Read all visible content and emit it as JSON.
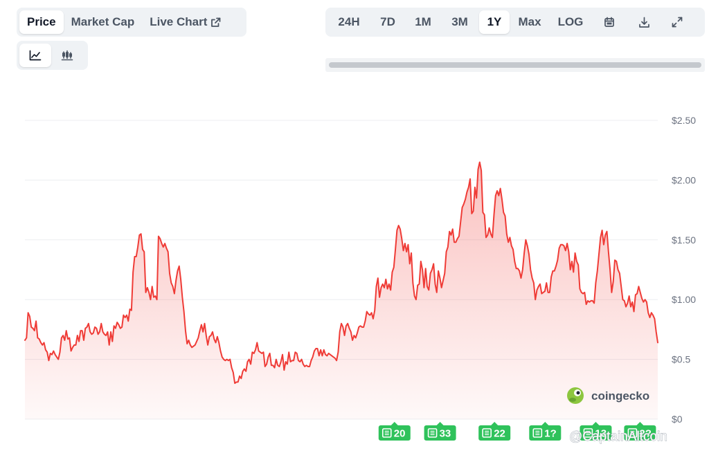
{
  "toolbar": {
    "type_tabs": [
      {
        "label": "Price",
        "active": true
      },
      {
        "label": "Market Cap",
        "active": false
      },
      {
        "label": "Live Chart",
        "active": false,
        "icon": "external-link-icon"
      }
    ],
    "view_toggle": [
      {
        "icon": "line-chart-icon",
        "active": true
      },
      {
        "icon": "candlestick-chart-icon",
        "active": false
      }
    ],
    "range_tabs": [
      {
        "label": "24H",
        "active": false
      },
      {
        "label": "7D",
        "active": false
      },
      {
        "label": "1M",
        "active": false
      },
      {
        "label": "3M",
        "active": false
      },
      {
        "label": "1Y",
        "active": true
      },
      {
        "label": "Max",
        "active": false
      },
      {
        "label": "LOG",
        "active": false
      }
    ],
    "icon_buttons": [
      "calendar-icon",
      "download-icon",
      "expand-icon"
    ]
  },
  "colors": {
    "line": "#ef3b36",
    "badge": "#2fc25b",
    "grid": "#eceef1",
    "axis_text": "#6b7280"
  },
  "watermark": {
    "brand": "coingecko",
    "handle": "@CaptainAltcoin"
  },
  "chart_data": {
    "type": "area",
    "title": "",
    "xlabel": "",
    "ylabel": "",
    "ylim": [
      0,
      2.5
    ],
    "ytick_labels": [
      "$0",
      "$0.5",
      "$1.00",
      "$1.50",
      "$2.00",
      "$2.50"
    ],
    "ytick_values": [
      0,
      0.5,
      1.0,
      1.5,
      2.0,
      2.5
    ],
    "x_range_label": "1Y",
    "grid": true,
    "series": [
      {
        "values": [
          0.66,
          0.68,
          0.89,
          0.86,
          0.77,
          0.76,
          0.74,
          0.82,
          0.68,
          0.67,
          0.64,
          0.62,
          0.64,
          0.58,
          0.56,
          0.49,
          0.55,
          0.54,
          0.57,
          0.54,
          0.52,
          0.5,
          0.56,
          0.68,
          0.7,
          0.66,
          0.74,
          0.67,
          0.68,
          0.57,
          0.6,
          0.62,
          0.62,
          0.7,
          0.65,
          0.74,
          0.74,
          0.66,
          0.76,
          0.77,
          0.8,
          0.73,
          0.71,
          0.72,
          0.77,
          0.76,
          0.71,
          0.73,
          0.8,
          0.73,
          0.71,
          0.7,
          0.73,
          0.62,
          0.73,
          0.65,
          0.78,
          0.76,
          0.81,
          0.79,
          0.76,
          0.77,
          0.87,
          0.85,
          0.87,
          0.82,
          0.92,
          0.91,
          1.23,
          1.36,
          1.36,
          1.44,
          1.54,
          1.55,
          1.42,
          1.4,
          1.06,
          1.1,
          1.06,
          1.0,
          1.11,
          1.02,
          1.03,
          1.0,
          1.53,
          1.51,
          1.47,
          1.44,
          1.47,
          1.43,
          1.4,
          1.22,
          1.14,
          1.11,
          1.05,
          1.16,
          1.24,
          1.28,
          1.17,
          1.02,
          0.9,
          0.74,
          0.63,
          0.66,
          0.62,
          0.6,
          0.61,
          0.62,
          0.65,
          0.68,
          0.74,
          0.79,
          0.73,
          0.8,
          0.7,
          0.62,
          0.69,
          0.7,
          0.73,
          0.67,
          0.64,
          0.69,
          0.64,
          0.57,
          0.52,
          0.5,
          0.49,
          0.5,
          0.49,
          0.5,
          0.43,
          0.39,
          0.3,
          0.31,
          0.31,
          0.36,
          0.34,
          0.4,
          0.42,
          0.4,
          0.48,
          0.5,
          0.46,
          0.56,
          0.55,
          0.58,
          0.64,
          0.57,
          0.56,
          0.55,
          0.56,
          0.44,
          0.46,
          0.52,
          0.55,
          0.45,
          0.45,
          0.43,
          0.5,
          0.45,
          0.44,
          0.48,
          0.54,
          0.41,
          0.48,
          0.46,
          0.56,
          0.48,
          0.49,
          0.49,
          0.56,
          0.55,
          0.49,
          0.48,
          0.5,
          0.46,
          0.44,
          0.45,
          0.44,
          0.44,
          0.49,
          0.52,
          0.57,
          0.59,
          0.59,
          0.53,
          0.58,
          0.53,
          0.58,
          0.54,
          0.53,
          0.55,
          0.54,
          0.53,
          0.52,
          0.51,
          0.49,
          0.56,
          0.73,
          0.8,
          0.77,
          0.7,
          0.78,
          0.8,
          0.76,
          0.73,
          0.66,
          0.7,
          0.68,
          0.72,
          0.77,
          0.78,
          0.77,
          0.77,
          0.82,
          0.9,
          0.88,
          0.87,
          0.89,
          0.84,
          0.91,
          1.11,
          1.18,
          1.02,
          1.1,
          1.13,
          1.1,
          1.17,
          1.09,
          1.13,
          1.08,
          1.23,
          1.27,
          1.42,
          1.58,
          1.62,
          1.59,
          1.51,
          1.41,
          1.47,
          1.4,
          1.46,
          1.3,
          1.39,
          1.14,
          1.03,
          1.0,
          1.12,
          1.13,
          1.32,
          1.25,
          1.1,
          1.26,
          1.11,
          1.08,
          1.22,
          1.25,
          1.3,
          1.13,
          1.06,
          1.24,
          1.18,
          1.1,
          1.16,
          1.22,
          1.4,
          1.44,
          1.57,
          1.54,
          1.59,
          1.48,
          1.48,
          1.51,
          1.53,
          1.65,
          1.77,
          1.8,
          1.84,
          1.9,
          1.94,
          2.01,
          1.72,
          1.74,
          1.94,
          1.85,
          2.09,
          2.15,
          2.08,
          1.73,
          1.71,
          1.52,
          1.54,
          1.6,
          1.55,
          1.52,
          1.71,
          1.87,
          1.91,
          1.87,
          1.93,
          1.84,
          1.73,
          1.7,
          1.55,
          1.48,
          1.52,
          1.45,
          1.42,
          1.32,
          1.26,
          1.26,
          1.24,
          1.18,
          1.25,
          1.39,
          1.5,
          1.45,
          1.38,
          1.25,
          1.18,
          1.14,
          1.0,
          1.08,
          1.11,
          1.13,
          1.05,
          1.06,
          1.07,
          1.14,
          1.06,
          1.06,
          1.19,
          1.24,
          1.24,
          1.28,
          1.33,
          1.43,
          1.46,
          1.46,
          1.45,
          1.41,
          1.47,
          1.4,
          1.25,
          1.32,
          1.23,
          1.39,
          1.32,
          1.29,
          1.09,
          1.06,
          1.05,
          1.06,
          0.96,
          0.99,
          0.98,
          0.99,
          0.99,
          0.97,
          1.14,
          1.24,
          1.38,
          1.52,
          1.58,
          1.46,
          1.54,
          1.57,
          1.4,
          1.25,
          1.06,
          1.15,
          1.33,
          1.32,
          1.25,
          1.22,
          1.11,
          1.0,
          0.99,
          0.94,
          0.97,
          1.03,
          0.94,
          0.98,
          0.9,
          1.04,
          1.05,
          1.11,
          1.06,
          1.01,
          0.98,
          1.0,
          0.98,
          0.89,
          0.85,
          0.89,
          0.87,
          0.84,
          0.73,
          0.64
        ]
      }
    ],
    "annotations": [
      {
        "type": "news-badge",
        "label": "20",
        "position": 0.584
      },
      {
        "type": "news-badge",
        "label": "33",
        "position": 0.656
      },
      {
        "type": "news-badge",
        "label": "22",
        "position": 0.742
      },
      {
        "type": "news-badge",
        "label": "1?",
        "position": 0.822
      },
      {
        "type": "news-badge",
        "label": "13",
        "position": 0.902
      },
      {
        "type": "news-badge",
        "label": "2?",
        "position": 0.972
      }
    ]
  }
}
